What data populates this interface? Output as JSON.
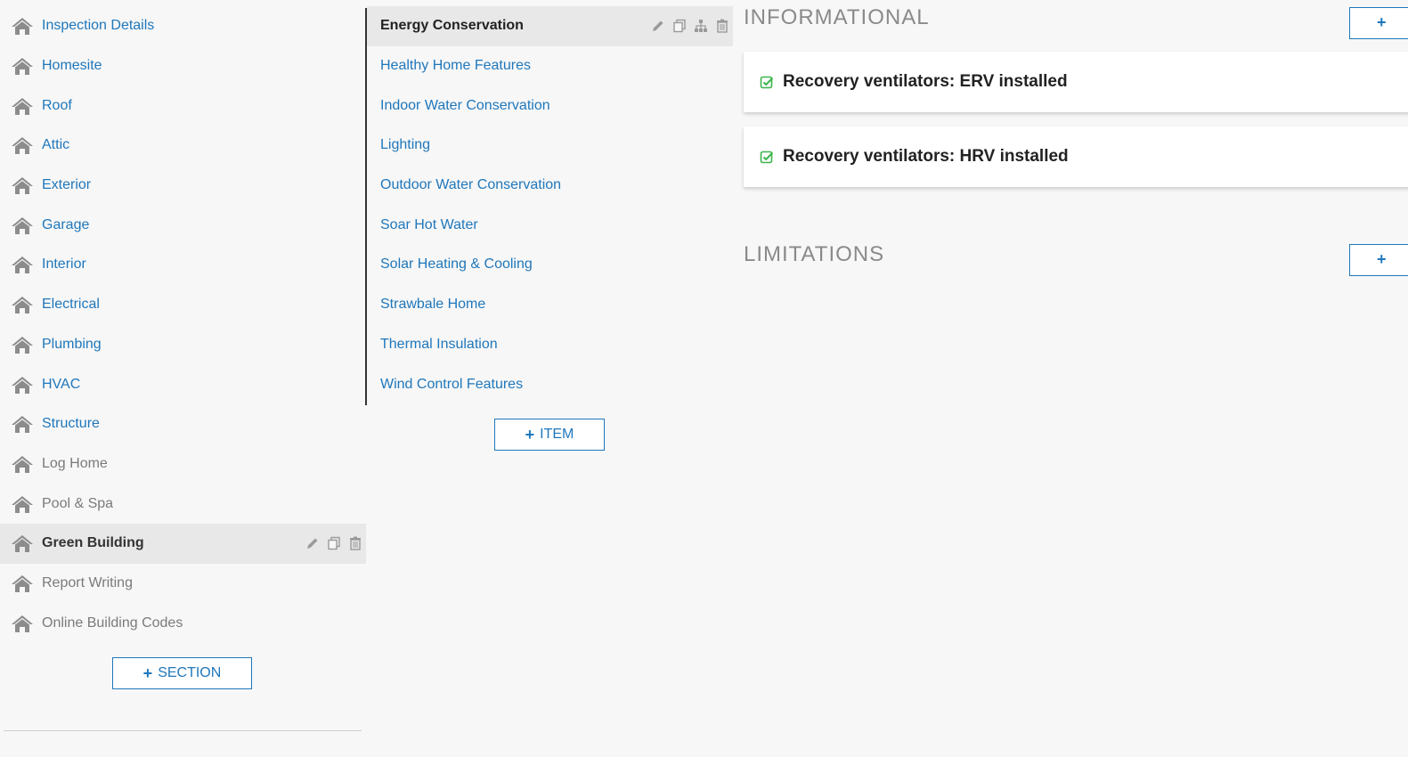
{
  "sections": {
    "items": [
      {
        "label": "Inspection Details",
        "state": "link"
      },
      {
        "label": "Homesite",
        "state": "link"
      },
      {
        "label": "Roof",
        "state": "link"
      },
      {
        "label": "Attic",
        "state": "link"
      },
      {
        "label": "Exterior",
        "state": "link"
      },
      {
        "label": "Garage",
        "state": "link"
      },
      {
        "label": "Interior",
        "state": "link"
      },
      {
        "label": "Electrical",
        "state": "link"
      },
      {
        "label": "Plumbing",
        "state": "link"
      },
      {
        "label": "HVAC",
        "state": "link"
      },
      {
        "label": "Structure",
        "state": "link"
      },
      {
        "label": "Log Home",
        "state": "muted"
      },
      {
        "label": "Pool & Spa",
        "state": "muted"
      },
      {
        "label": "Green Building",
        "state": "active"
      },
      {
        "label": "Report Writing",
        "state": "muted"
      },
      {
        "label": "Online Building Codes",
        "state": "muted"
      }
    ],
    "add_button": {
      "plus": "+",
      "label": "SECTION"
    }
  },
  "items": {
    "list": [
      {
        "label": "Energy Conservation",
        "state": "active"
      },
      {
        "label": "Healthy Home Features",
        "state": "link"
      },
      {
        "label": "Indoor Water Conservation",
        "state": "link"
      },
      {
        "label": "Lighting",
        "state": "link"
      },
      {
        "label": "Outdoor Water Conservation",
        "state": "link"
      },
      {
        "label": "Soar Hot Water",
        "state": "link"
      },
      {
        "label": "Solar Heating & Cooling",
        "state": "link"
      },
      {
        "label": "Strawbale Home",
        "state": "link"
      },
      {
        "label": "Thermal Insulation",
        "state": "link"
      },
      {
        "label": "Wind Control Features",
        "state": "link"
      }
    ],
    "add_button": {
      "plus": "+",
      "label": "ITEM"
    }
  },
  "comments": {
    "informational": {
      "heading": "INFORMATIONAL",
      "add_plus": "+",
      "cards": [
        {
          "title": "Recovery ventilators: ERV installed"
        },
        {
          "title": "Recovery ventilators: HRV installed"
        }
      ]
    },
    "limitations": {
      "heading": "LIMITATIONS",
      "add_plus": "+"
    }
  },
  "colors": {
    "link": "#1f77bb",
    "muted": "#7a7a7a",
    "active_bg": "#e8e8e8",
    "check": "#3cb44b",
    "icon_gray": "#8c8c8c"
  },
  "icons": {
    "section_icon": "house-icon",
    "edit": "pencil-icon",
    "copy": "copy-icon",
    "tree": "sitemap-icon",
    "delete": "trash-icon",
    "checked": "checkbox-checked-icon"
  }
}
